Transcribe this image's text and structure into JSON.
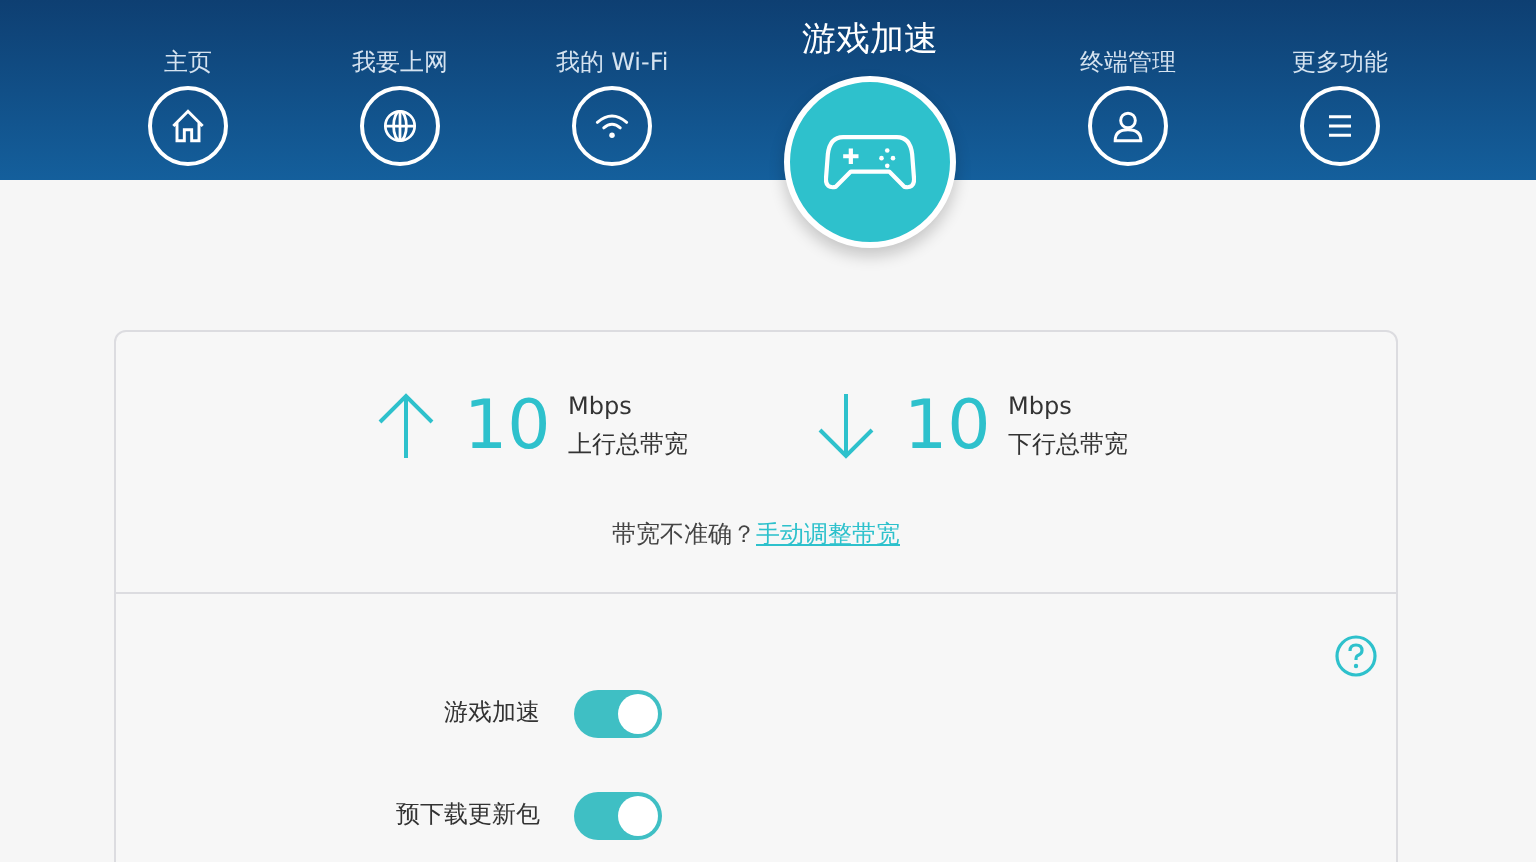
{
  "nav": [
    {
      "label": "主页",
      "kind": "home",
      "selected": false
    },
    {
      "label": "我要上网",
      "kind": "globe",
      "selected": false
    },
    {
      "label": "我的 Wi-Fi",
      "kind": "wifi",
      "selected": false
    },
    {
      "label": "游戏加速",
      "kind": "gamepad",
      "selected": true
    },
    {
      "label": "终端管理",
      "kind": "user",
      "selected": false
    },
    {
      "label": "更多功能",
      "kind": "menu",
      "selected": false
    }
  ],
  "bandwidth": [
    {
      "kind": "up",
      "value": "10",
      "unit": "Mbps",
      "label": "上行总带宽"
    },
    {
      "kind": "down",
      "value": "10",
      "unit": "Mbps",
      "label": "下行总带宽"
    }
  ],
  "hint": {
    "text": "带宽不准确？",
    "link": "手动调整带宽"
  },
  "settings": [
    {
      "label": "游戏加速",
      "on": true
    },
    {
      "label": "预下载更新包",
      "on": true
    }
  ]
}
